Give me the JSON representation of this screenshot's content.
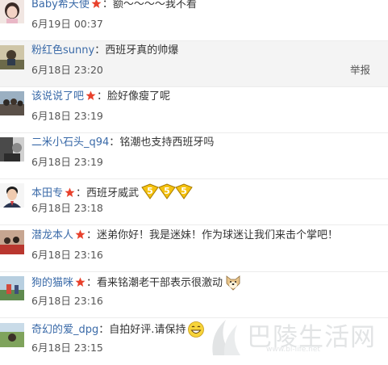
{
  "colors": {
    "username": "#3a6aa8",
    "text": "#333333",
    "timestamp": "#555555",
    "vip_badge": "#e8412c",
    "divider": "#ececec",
    "hover_row": "#f4f4f4"
  },
  "comments": [
    {
      "user": "Baby希天使",
      "vip": true,
      "separator": "：",
      "text": "额～～～～我不看",
      "time": "6月19日 00:37",
      "avatar_icon": "avatar-girl-icon"
    },
    {
      "user": "粉红色sunny",
      "vip": false,
      "separator": "：",
      "text": "西班牙真的帅爆",
      "time": "6月18日 23:20",
      "report": "举报",
      "avatar_icon": "avatar-photo-icon"
    },
    {
      "user": "该说说了吧",
      "vip": true,
      "separator": "：",
      "text": "脸好像瘦了呢",
      "time": "6月18日 23:19",
      "avatar_icon": "avatar-crowd-icon"
    },
    {
      "user": "二米小石头_q94",
      "vip": false,
      "separator": "：",
      "text": "铭潮也支持西班牙吗",
      "time": "6月18日 23:19",
      "avatar_icon": "avatar-mono-icon"
    },
    {
      "user": "本田专",
      "vip": true,
      "separator": "：",
      "text": "西班牙威武",
      "time": "6月18日 23:18",
      "emoji": "five-emoji-icon",
      "avatar_icon": "avatar-man-icon"
    },
    {
      "user": "潜龙本人",
      "vip": true,
      "separator": "：",
      "text": "迷弟你好！我是迷妹！作为球迷让我们来击个掌吧！",
      "time": "6月18日 23:16",
      "avatar_icon": "avatar-group-icon"
    },
    {
      "user": "狗的猫咪",
      "vip": true,
      "separator": "：",
      "text": "看来铭潮老干部表示很激动",
      "time": "6月18日 23:16",
      "emoji": "doge-emoji-icon",
      "avatar_icon": "avatar-outdoor-icon"
    },
    {
      "user": "奇幻的爱_dpg",
      "vip": false,
      "separator": "：",
      "text": "自拍好评.请保持",
      "time": "6月18日 23:15",
      "emoji": "grin-emoji-icon",
      "avatar_icon": "avatar-landscape-icon"
    }
  ],
  "watermark": {
    "text": "巴陵生活网",
    "url": "www.bl-life.net"
  }
}
